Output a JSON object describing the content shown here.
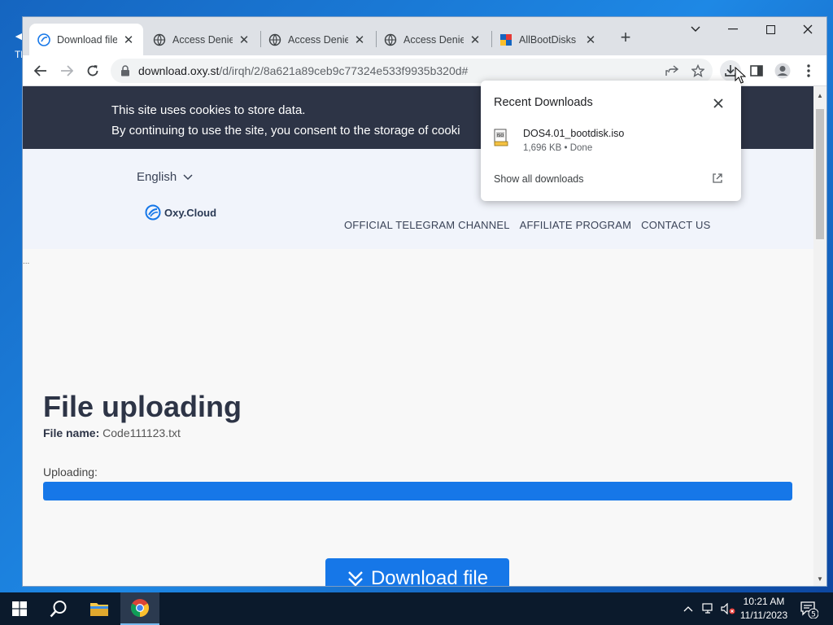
{
  "desktop": {
    "frag1": "◄",
    "frag2": "Tl"
  },
  "tabs": [
    {
      "title": "Download file",
      "active": true
    },
    {
      "title": "Access Denied",
      "active": false
    },
    {
      "title": "Access Denied",
      "active": false
    },
    {
      "title": "Access Denied",
      "active": false
    },
    {
      "title": "AllBootDisks I",
      "active": false
    }
  ],
  "toolbar": {
    "url_host": "download.oxy.st",
    "url_path": "/d/irqh/2/8a621a89ceb9c77324e533f9935b320d#"
  },
  "cookie": {
    "line1": "This site uses cookies to store data.",
    "line2": "By continuing to use the site, you consent to the storage of cooki"
  },
  "site": {
    "language": "English",
    "logo_text": "Oxy.Cloud",
    "nav": [
      "OFFICIAL TELEGRAM CHANNEL",
      "AFFILIATE PROGRAM",
      "CONTACT US"
    ],
    "ellipsis": "...",
    "title": "File uploading",
    "file_label": "File name:",
    "file_name": "Code111123.txt",
    "uploading_label": "Uploading:",
    "progress_percent": 100,
    "download_button": "Download file"
  },
  "downloads": {
    "heading": "Recent Downloads",
    "item_name": "DOS4.01_bootdisk.iso",
    "item_meta": "1,696 KB • Done",
    "show_all": "Show all downloads"
  },
  "taskbar": {
    "time": "10:21 AM",
    "date": "11/11/2023",
    "notif_count": "5"
  },
  "colors": {
    "accent": "#1677e8",
    "cookie_bg": "#2d3446",
    "taskbar_bg": "#0b1a2c"
  }
}
